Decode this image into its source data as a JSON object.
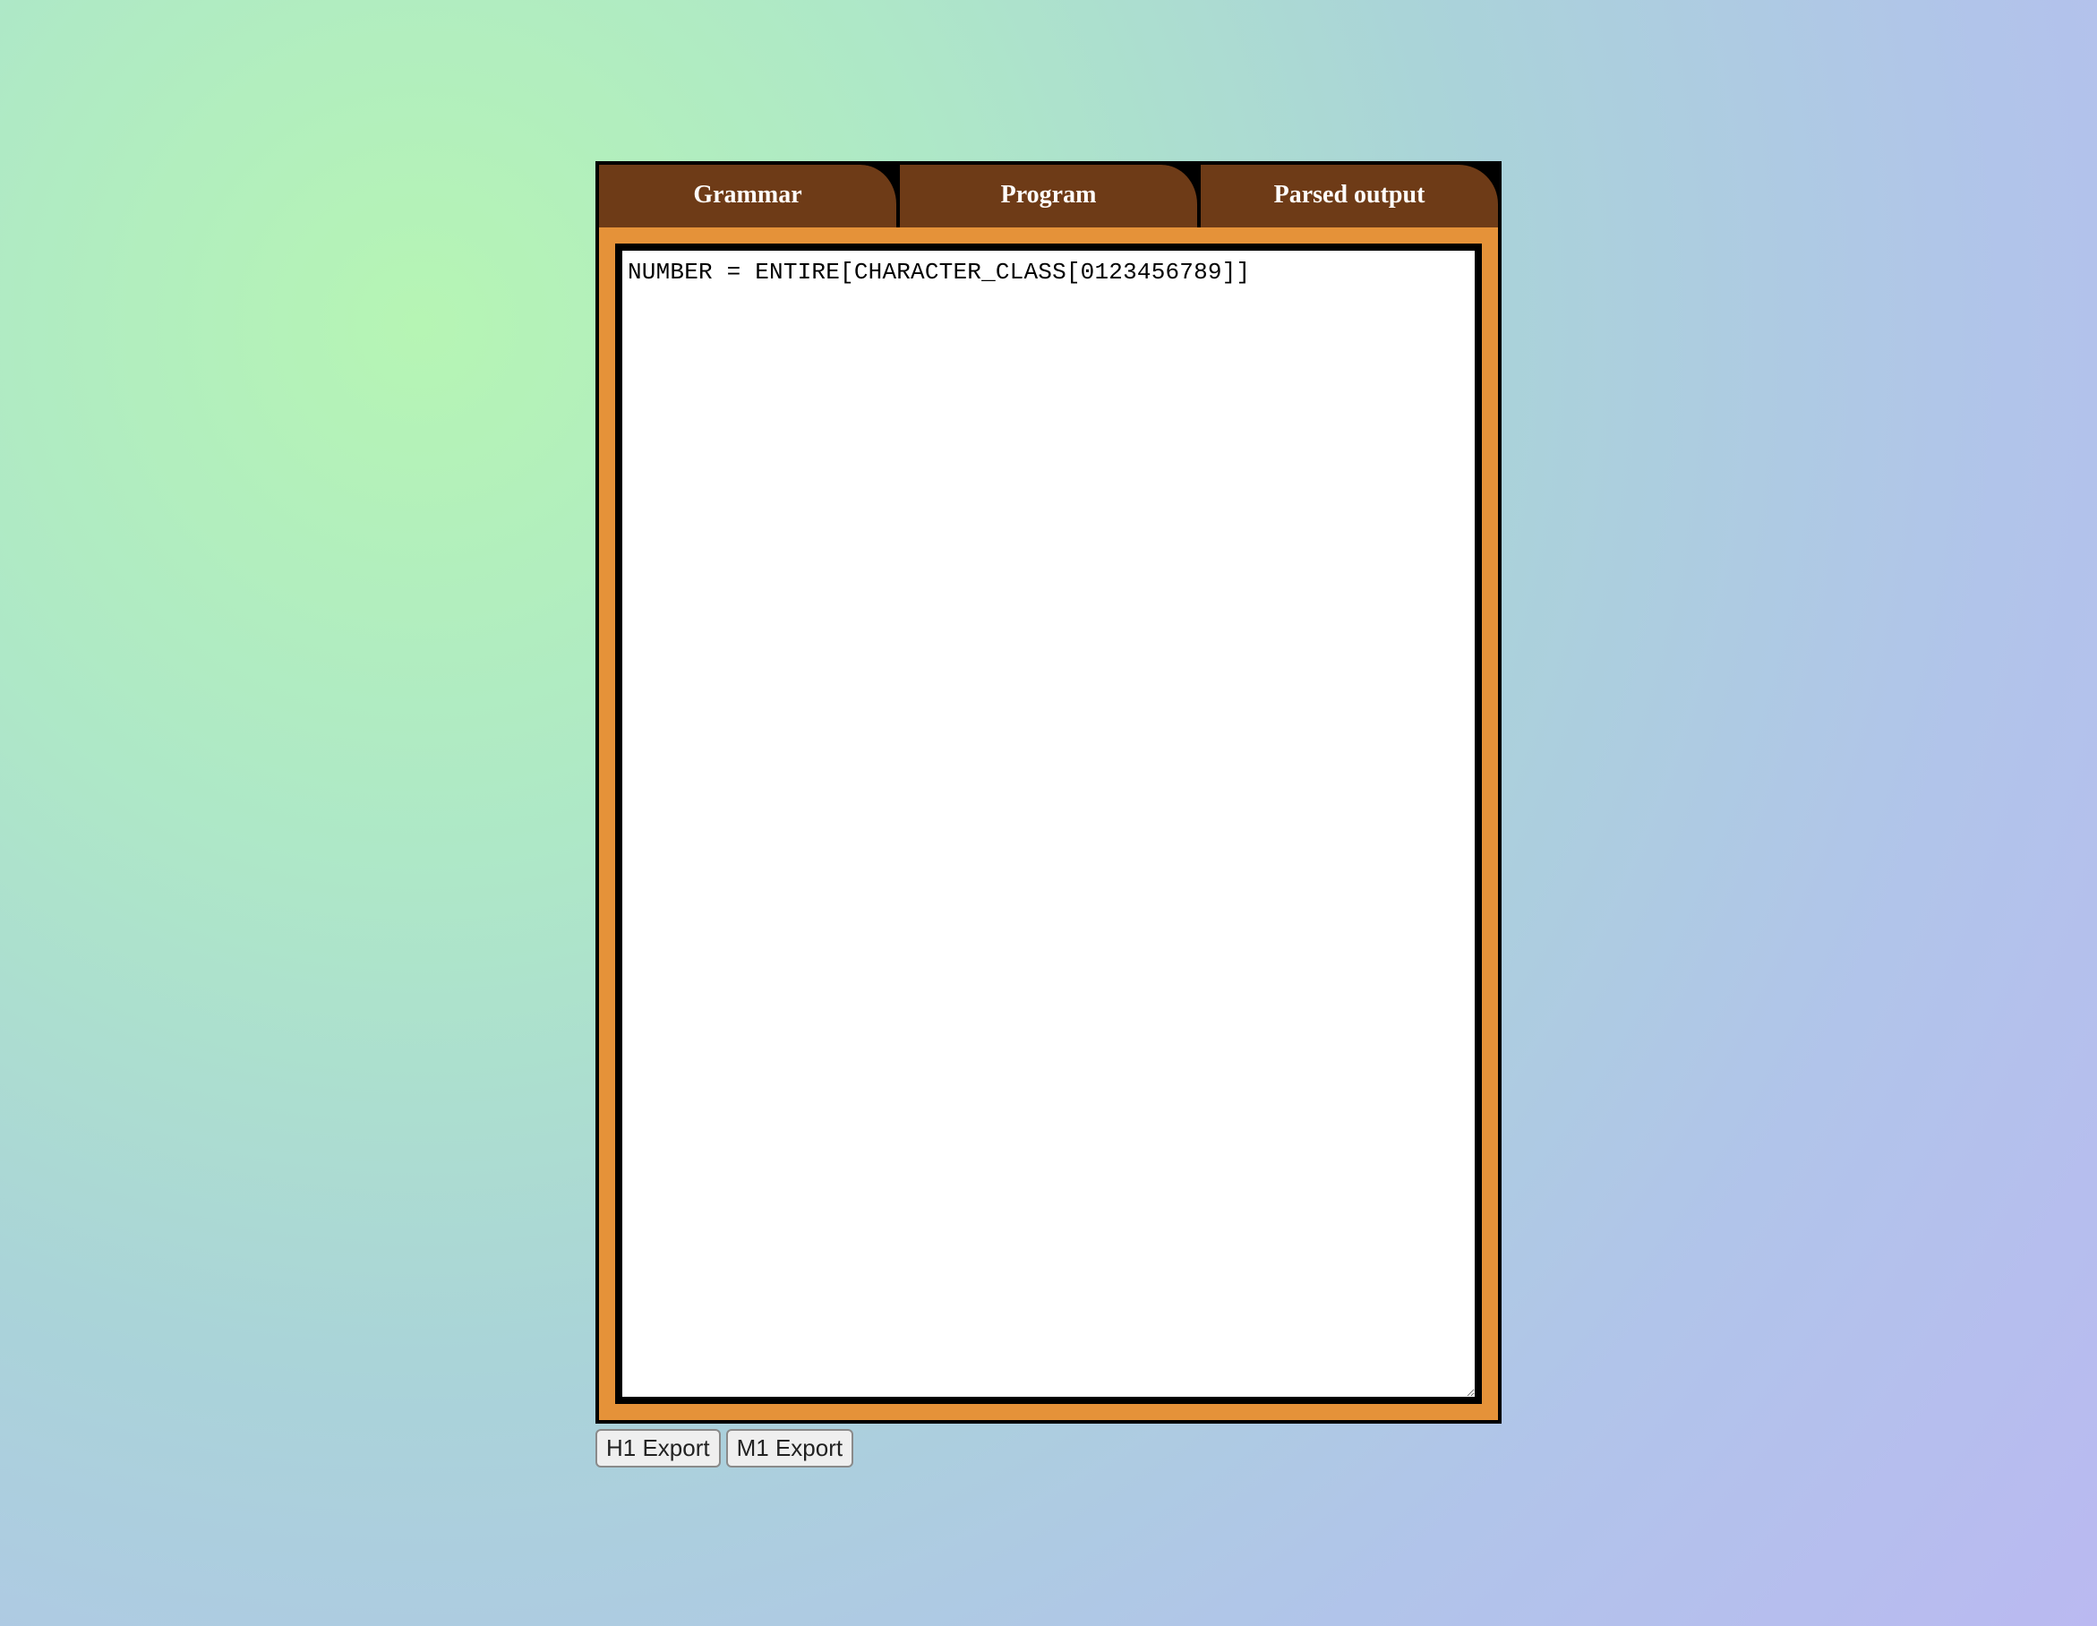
{
  "tabs": {
    "grammar": {
      "label": "Grammar"
    },
    "program": {
      "label": "Program"
    },
    "parsed": {
      "label": "Parsed output",
      "active": true
    }
  },
  "editor": {
    "content": "NUMBER = ENTIRE[CHARACTER_CLASS[0123456789]]"
  },
  "buttons": {
    "h1_export": "H1 Export",
    "m1_export": "M1 Export"
  },
  "colors": {
    "tab_bg": "#6e3b17",
    "panel_bg": "#e59239",
    "border": "#000000"
  }
}
